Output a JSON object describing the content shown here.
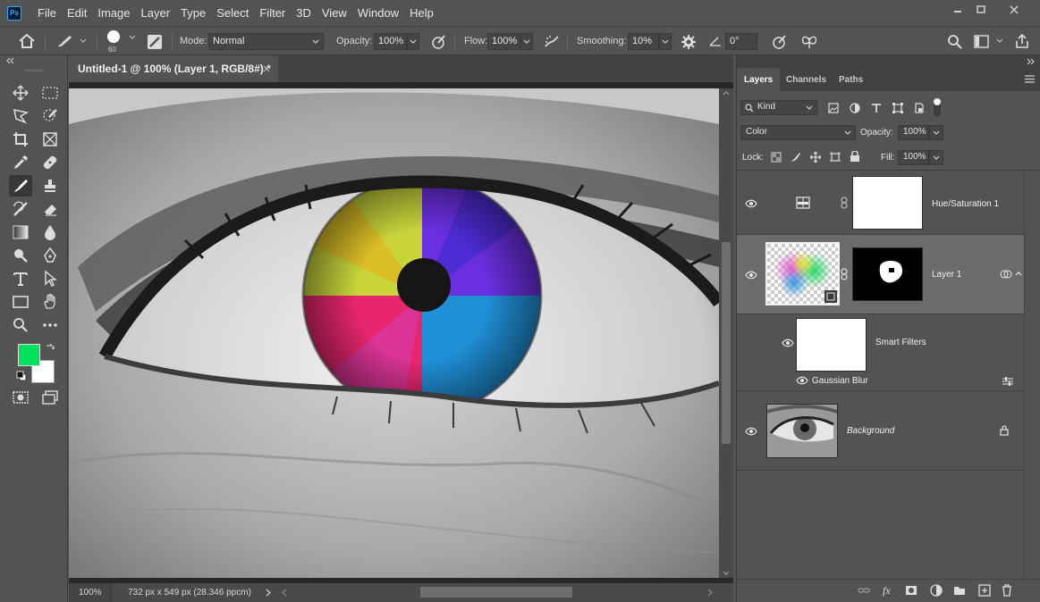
{
  "app": {
    "logo_text": "Ps"
  },
  "menu": [
    "File",
    "Edit",
    "Image",
    "Layer",
    "Type",
    "Select",
    "Filter",
    "3D",
    "View",
    "Window",
    "Help"
  ],
  "options": {
    "brush_size": "60",
    "mode_label": "Mode:",
    "mode_value": "Normal",
    "opacity_label": "Opacity:",
    "opacity_value": "100%",
    "flow_label": "Flow:",
    "flow_value": "100%",
    "smoothing_label": "Smoothing:",
    "smoothing_value": "10%",
    "angle_value": "0°"
  },
  "document": {
    "tab_title": "Untitled-1 @ 100% (Layer 1, RGB/8#) *",
    "zoom": "100%",
    "doc_info": "732 px x 549 px (28.346 ppcm)"
  },
  "colors": {
    "foreground": "#00e05a",
    "background": "#ffffff"
  },
  "panel": {
    "tabs": [
      "Layers",
      "Channels",
      "Paths"
    ],
    "filter_kind": "Kind",
    "blend_mode": "Color",
    "opacity_label": "Opacity:",
    "opacity_value": "100%",
    "lock_label": "Lock:",
    "fill_label": "Fill:",
    "fill_value": "100%",
    "layers": [
      {
        "name": "Hue/Saturation 1"
      },
      {
        "name": "Layer 1"
      },
      {
        "name": "Smart Filters"
      },
      {
        "name": "Gaussian Blur"
      },
      {
        "name": "Background"
      }
    ]
  }
}
